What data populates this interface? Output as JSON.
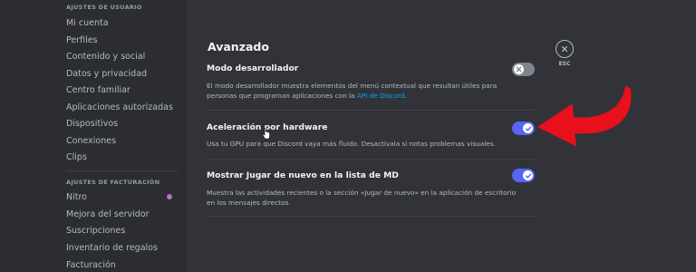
{
  "sidebar": {
    "user_settings_header": "AJUSTES DE USUARIO",
    "user_items": [
      {
        "label": "Mi cuenta"
      },
      {
        "label": "Perfiles"
      },
      {
        "label": "Contenido y social"
      },
      {
        "label": "Datos y privacidad"
      },
      {
        "label": "Centro familiar"
      },
      {
        "label": "Aplicaciones autorizadas"
      },
      {
        "label": "Dispositivos"
      },
      {
        "label": "Conexiones"
      },
      {
        "label": "Clips"
      }
    ],
    "billing_header": "AJUSTES DE FACTURACIÓN",
    "billing_items": [
      {
        "label": "Nitro"
      },
      {
        "label": "Mejora del servidor"
      },
      {
        "label": "Suscripciones"
      },
      {
        "label": "Inventario de regalos"
      },
      {
        "label": "Facturación"
      }
    ]
  },
  "main": {
    "title": "Avanzado",
    "settings": [
      {
        "title": "Modo desarrollador",
        "desc_before_link": "El modo desarrollador muestra elementos del menú contextual que resultan útiles para personas que programan aplicaciones con la ",
        "link": "API de Discord",
        "desc_after_link": ".",
        "enabled": false
      },
      {
        "title": "Aceleración por hardware",
        "desc": "Usa tu GPU para que Discord vaya más fluido. Desactívala si notas problemas visuales.",
        "enabled": true
      },
      {
        "title": "Mostrar Jugar de nuevo en la lista de MD",
        "desc": "Muestra las actividades recientes o la sección «Jugar de nuevo» en la aplicación de escritorio en los mensajes directos.",
        "enabled": true
      }
    ],
    "esc_label": "ESC"
  },
  "colors": {
    "accent": "#5865f2",
    "toggle_off": "#80848e",
    "arrow": "#e8101a",
    "link": "#00a8fc"
  },
  "icons": [
    "close-icon",
    "check-icon",
    "x-icon",
    "red-arrow",
    "pointer-cursor"
  ]
}
